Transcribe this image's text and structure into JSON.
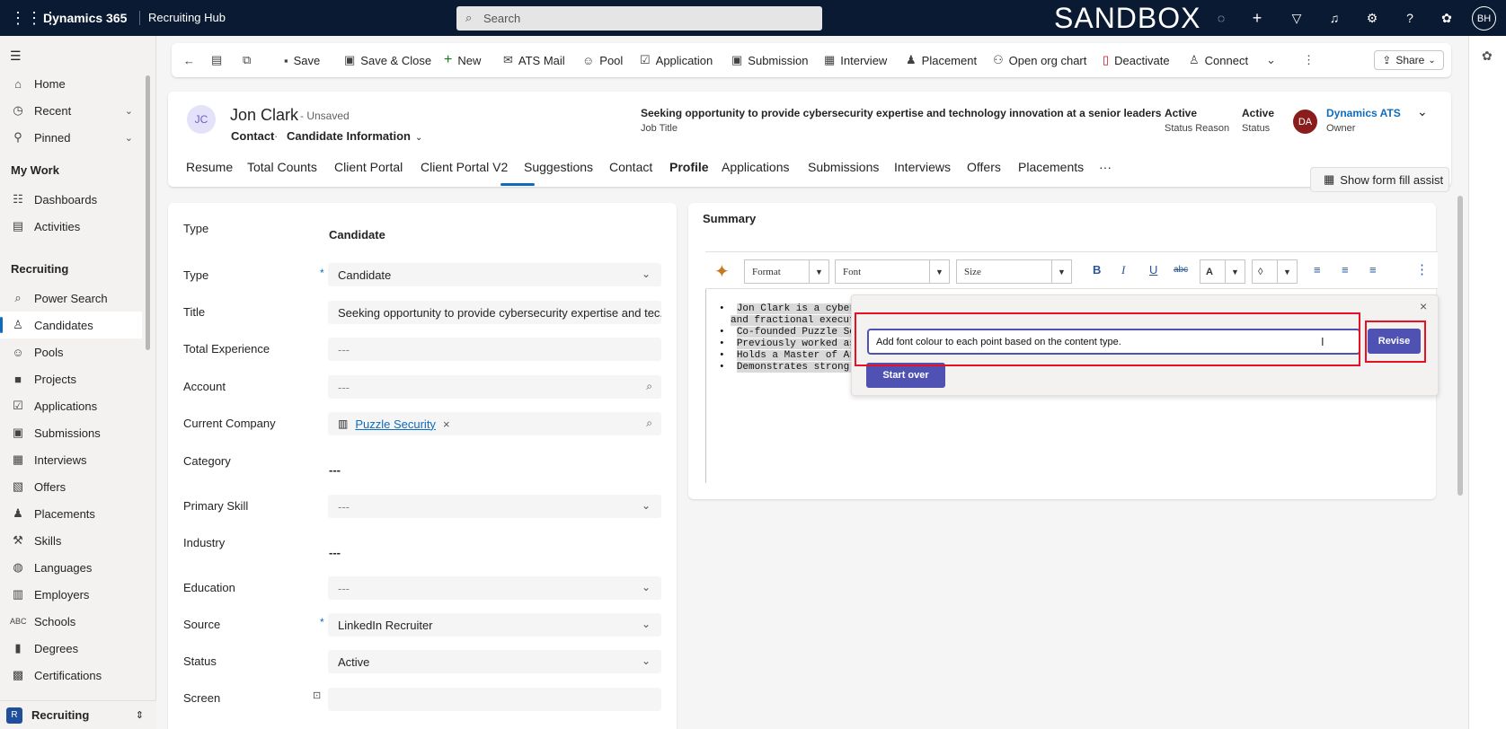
{
  "topbar": {
    "app_name": "Dynamics 365",
    "area": "Recruiting Hub",
    "search_placeholder": "Search",
    "env_label": "SANDBOX",
    "user_initials": "BH"
  },
  "nav": {
    "home": "Home",
    "recent": "Recent",
    "pinned": "Pinned",
    "section_mywork": "My Work",
    "dashboards": "Dashboards",
    "activities": "Activities",
    "section_recruiting": "Recruiting",
    "power_search": "Power Search",
    "candidates": "Candidates",
    "pools": "Pools",
    "projects": "Projects",
    "applications": "Applications",
    "submissions": "Submissions",
    "interviews": "Interviews",
    "offers": "Offers",
    "placements": "Placements",
    "skills": "Skills",
    "languages": "Languages",
    "employers": "Employers",
    "schools": "Schools",
    "degrees": "Degrees",
    "certifications": "Certifications",
    "area_switch": "Recruiting",
    "area_badge": "R"
  },
  "commands": {
    "save": "Save",
    "save_close": "Save & Close",
    "new": "New",
    "ats_mail": "ATS Mail",
    "pool": "Pool",
    "application": "Application",
    "submission": "Submission",
    "interview": "Interview",
    "placement": "Placement",
    "org_chart": "Open org chart",
    "deactivate": "Deactivate",
    "connect": "Connect",
    "share": "Share"
  },
  "record": {
    "initials": "JC",
    "name": "Jon Clark",
    "save_state": "- Unsaved",
    "entity": "Contact",
    "form": "Candidate Information",
    "job_title": "Seeking opportunity to provide cybersecurity expertise and technology innovation at a senior leaders",
    "job_title_label": "Job Title",
    "status_reason": "Active",
    "status_reason_label": "Status Reason",
    "status": "Active",
    "status_label": "Status",
    "owner_initials": "DA",
    "owner": "Dynamics ATS",
    "owner_label": "Owner"
  },
  "tabs": [
    "Resume",
    "Total Counts",
    "Client Portal",
    "Client Portal V2",
    "Suggestions",
    "Contact",
    "Profile",
    "Applications",
    "Submissions",
    "Interviews",
    "Offers",
    "Placements",
    "···"
  ],
  "form_fill_assist": "Show form fill assist",
  "fields": {
    "type1_label": "Type",
    "type1_value": "Candidate",
    "type2_label": "Type",
    "type2_value": "Candidate",
    "title_label": "Title",
    "title_value": "Seeking opportunity to provide cybersecurity expertise and tec...",
    "total_exp_label": "Total Experience",
    "total_exp_value": "---",
    "account_label": "Account",
    "account_value": "---",
    "current_company_label": "Current Company",
    "current_company_value": "Puzzle Security",
    "category_label": "Category",
    "category_value": "---",
    "primary_skill_label": "Primary Skill",
    "primary_skill_value": "---",
    "industry_label": "Industry",
    "industry_value": "---",
    "education_label": "Education",
    "education_value": "---",
    "source_label": "Source",
    "source_value": "LinkedIn Recruiter",
    "status_label": "Status",
    "status_value": "Active",
    "screen_label": "Screen",
    "screen_value": ""
  },
  "summary": {
    "title": "Summary",
    "format": "Format",
    "font": "Font",
    "size": "Size",
    "bullets": [
      "Jon Clark is a cybersecuri",
      "and fractional executive l",
      "Co-founded Puzzle Securi",
      "Previously worked as Chi",
      "Holds a Master of Arts (M",
      "Demonstrates strong skil"
    ]
  },
  "copilot": {
    "prompt_value": "Add font colour to each point based on the content type.",
    "revise": "Revise",
    "start_over": "Start over",
    "close": "×"
  },
  "colors": {
    "topbar": "#0b1a33",
    "accent": "#0f6cbd",
    "copilot_button": "#4f52b2",
    "highlight_box": "#e81123"
  }
}
